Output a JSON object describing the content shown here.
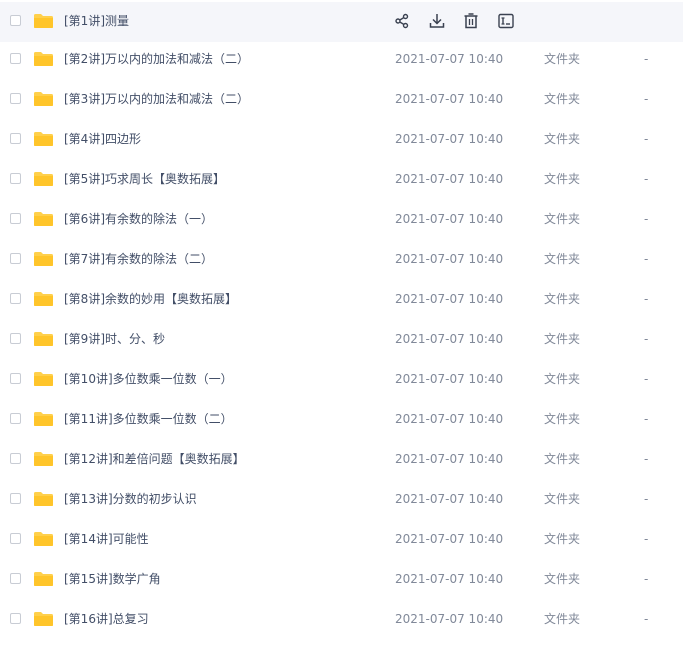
{
  "files": [
    {
      "name": "[第1讲]测量",
      "date": "",
      "type": "",
      "size": ""
    },
    {
      "name": "[第2讲]万以内的加法和减法（二）",
      "date": "2021-07-07 10:40",
      "type": "文件夹",
      "size": "-"
    },
    {
      "name": "[第3讲]万以内的加法和减法（二）",
      "date": "2021-07-07 10:40",
      "type": "文件夹",
      "size": "-"
    },
    {
      "name": "[第4讲]四边形",
      "date": "2021-07-07 10:40",
      "type": "文件夹",
      "size": "-"
    },
    {
      "name": "[第5讲]巧求周长【奥数拓展】",
      "date": "2021-07-07 10:40",
      "type": "文件夹",
      "size": "-"
    },
    {
      "name": "[第6讲]有余数的除法（一）",
      "date": "2021-07-07 10:40",
      "type": "文件夹",
      "size": "-"
    },
    {
      "name": "[第7讲]有余数的除法（二）",
      "date": "2021-07-07 10:40",
      "type": "文件夹",
      "size": "-"
    },
    {
      "name": "[第8讲]余数的妙用【奥数拓展】",
      "date": "2021-07-07 10:40",
      "type": "文件夹",
      "size": "-"
    },
    {
      "name": "[第9讲]时、分、秒",
      "date": "2021-07-07 10:40",
      "type": "文件夹",
      "size": "-"
    },
    {
      "name": "[第10讲]多位数乘一位数（一）",
      "date": "2021-07-07 10:40",
      "type": "文件夹",
      "size": "-"
    },
    {
      "name": "[第11讲]多位数乘一位数（二）",
      "date": "2021-07-07 10:40",
      "type": "文件夹",
      "size": "-"
    },
    {
      "name": "[第12讲]和差倍问题【奥数拓展】",
      "date": "2021-07-07 10:40",
      "type": "文件夹",
      "size": "-"
    },
    {
      "name": "[第13讲]分数的初步认识",
      "date": "2021-07-07 10:40",
      "type": "文件夹",
      "size": "-"
    },
    {
      "name": "[第14讲]可能性",
      "date": "2021-07-07 10:40",
      "type": "文件夹",
      "size": "-"
    },
    {
      "name": "[第15讲]数学广角",
      "date": "2021-07-07 10:40",
      "type": "文件夹",
      "size": "-"
    },
    {
      "name": "[第16讲]总复习",
      "date": "2021-07-07 10:40",
      "type": "文件夹",
      "size": "-"
    }
  ],
  "hover_actions": [
    "share-icon",
    "download-icon",
    "delete-icon",
    "rename-icon"
  ],
  "colors": {
    "folder": "#ffd04b",
    "hover_bg": "#f5f6fa",
    "name_text": "#424e67",
    "meta_text": "#818999"
  }
}
